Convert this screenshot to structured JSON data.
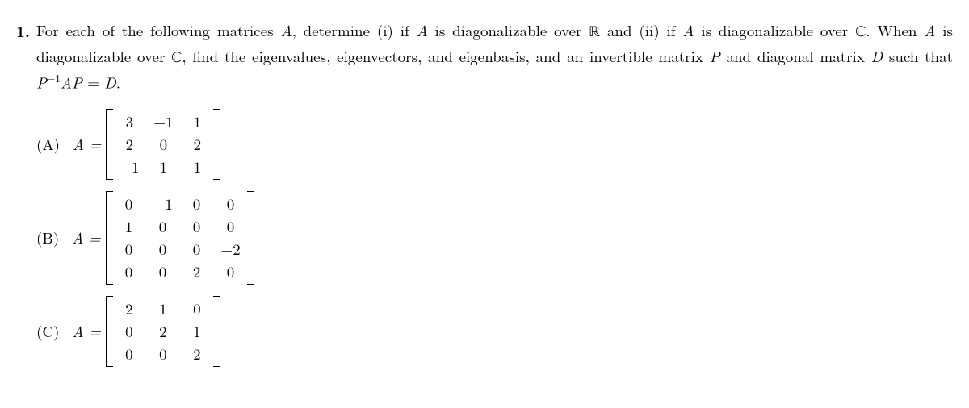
{
  "problem": {
    "number": "1.",
    "text_parts": {
      "t1": "For each of the following matrices ",
      "A": "A",
      "t2": ", determine (i) if ",
      "t3": " is diagonalizable over ",
      "R": "ℝ",
      "t4": " and (ii) if ",
      "t5": " is diagonalizable over ",
      "C": "ℂ",
      "t6": ". When ",
      "t7": " is diagonalizable over ",
      "t8": ", find the eigenvalues, eigenvectors, and eigenbasis, and an invertible matrix ",
      "P": "P",
      "t9": " and diagonal matrix ",
      "D": "D",
      "t10": " such that ",
      "eq_pinv": "P",
      "eq_sup": "−1",
      "eq_ap": "AP",
      "eq_eq": " = ",
      "eq_d": "D",
      "t11": "."
    }
  },
  "parts": [
    {
      "label": "(A)",
      "lhs": "A =",
      "cols": 3,
      "matrix": [
        [
          "3",
          "−1",
          "1"
        ],
        [
          "2",
          "0",
          "2"
        ],
        [
          "−1",
          "1",
          "1"
        ]
      ]
    },
    {
      "label": "(B)",
      "lhs": "A =",
      "cols": 4,
      "matrix": [
        [
          "0",
          "−1",
          "0",
          "0"
        ],
        [
          "1",
          "0",
          "0",
          "0"
        ],
        [
          "0",
          "0",
          "0",
          "−2"
        ],
        [
          "0",
          "0",
          "2",
          "0"
        ]
      ]
    },
    {
      "label": "(C)",
      "lhs": "A =",
      "cols": 3,
      "matrix": [
        [
          "2",
          "1",
          "0"
        ],
        [
          "0",
          "2",
          "1"
        ],
        [
          "0",
          "0",
          "2"
        ]
      ]
    }
  ]
}
